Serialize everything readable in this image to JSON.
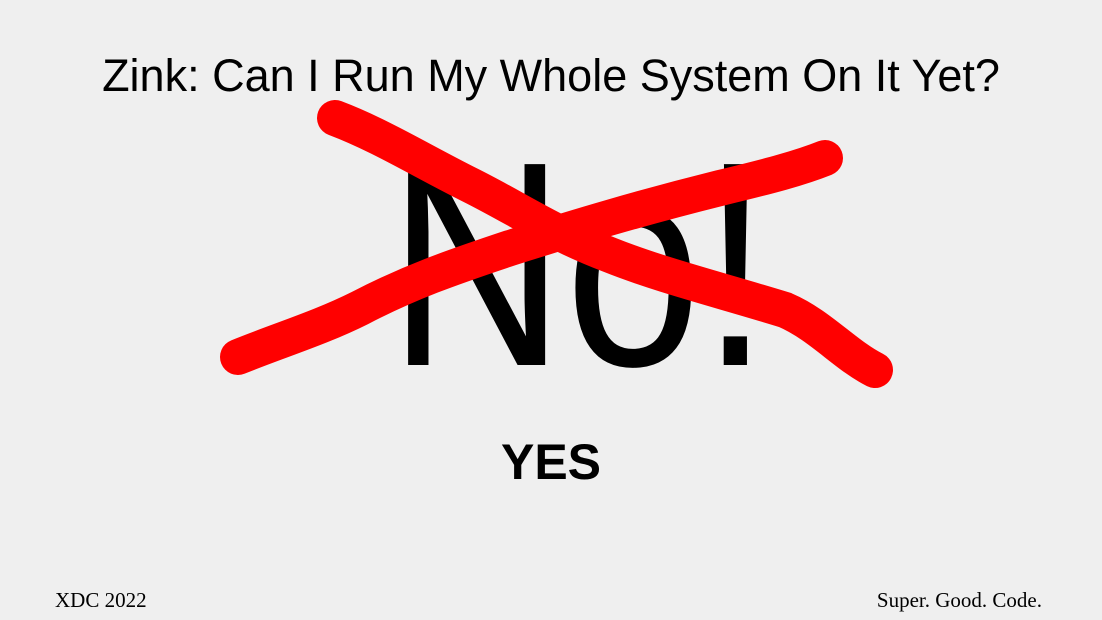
{
  "slide": {
    "title": "Zink: Can I Run My Whole System On It Yet?",
    "crossed_out_answer": "No!",
    "answer": "YES",
    "footer_left": "XDC 2022",
    "footer_right": "Super. Good. Code."
  },
  "colors": {
    "background": "#efefef",
    "strike_mark": "#ff0000",
    "text": "#000000"
  }
}
